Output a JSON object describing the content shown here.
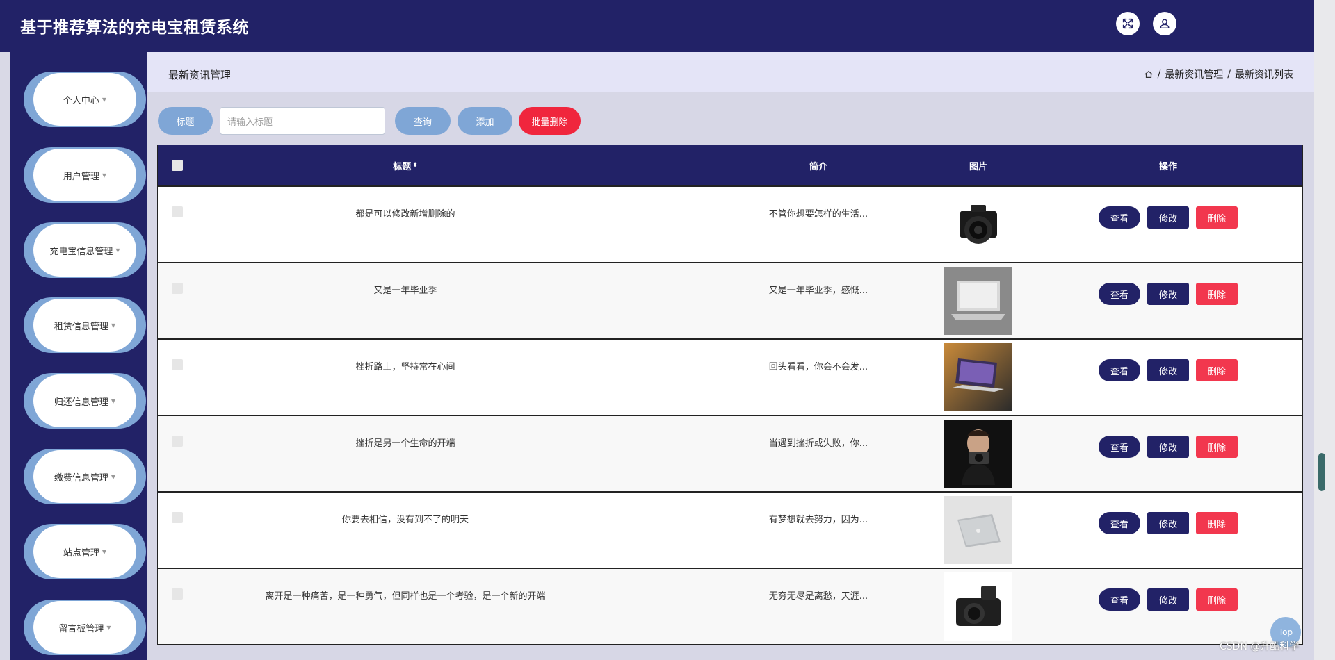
{
  "app": {
    "title": "基于推荐算法的充电宝租赁系统"
  },
  "header": {
    "icons": [
      "fullscreen-icon",
      "user-icon"
    ]
  },
  "sidebar": {
    "items": [
      {
        "label": "个人中心"
      },
      {
        "label": "用户管理"
      },
      {
        "label": "充电宝信息管理"
      },
      {
        "label": "租赁信息管理"
      },
      {
        "label": "归还信息管理"
      },
      {
        "label": "缴费信息管理"
      },
      {
        "label": "站点管理"
      },
      {
        "label": "留言板管理"
      }
    ]
  },
  "page": {
    "title": "最新资讯管理",
    "breadcrumb": [
      "最新资讯管理",
      "最新资讯列表"
    ],
    "breadcrumb_sep": "/"
  },
  "toolbar": {
    "title_label": "标题",
    "search_placeholder": "请输入标题",
    "query_label": "查询",
    "add_label": "添加",
    "batch_delete_label": "批量删除"
  },
  "table": {
    "columns": {
      "title": "标题",
      "intro": "简介",
      "picture": "图片",
      "ops": "操作"
    },
    "ops": {
      "view": "查看",
      "edit": "修改",
      "delete": "删除"
    },
    "rows": [
      {
        "title": "都是可以修改新增删除的",
        "intro": "不管你想要怎样的生活...",
        "image": "camera"
      },
      {
        "title": "又是一年毕业季",
        "intro": "又是一年毕业季，感慨...",
        "image": "laptop-open"
      },
      {
        "title": "挫折路上，坚持常在心间",
        "intro": "回头看看，你会不会发...",
        "image": "laptop-dark"
      },
      {
        "title": "挫折是另一个生命的开端",
        "intro": "当遇到挫折或失败，你...",
        "image": "man-camera"
      },
      {
        "title": "你要去相信，没有到不了的明天",
        "intro": "有梦想就去努力，因为...",
        "image": "laptop-closed"
      },
      {
        "title": "离开是一种痛苦，是一种勇气，但同样也是一个考验，是一个新的开端",
        "intro": "无穷无尽是离愁，天涯...",
        "image": "compact-camera"
      }
    ]
  },
  "top_button": {
    "label": "Top"
  },
  "watermark": {
    "text": "CSDN @升酷科学"
  },
  "colors": {
    "primary": "#222267",
    "accent": "#7fa6d6",
    "danger": "#f0263d"
  }
}
